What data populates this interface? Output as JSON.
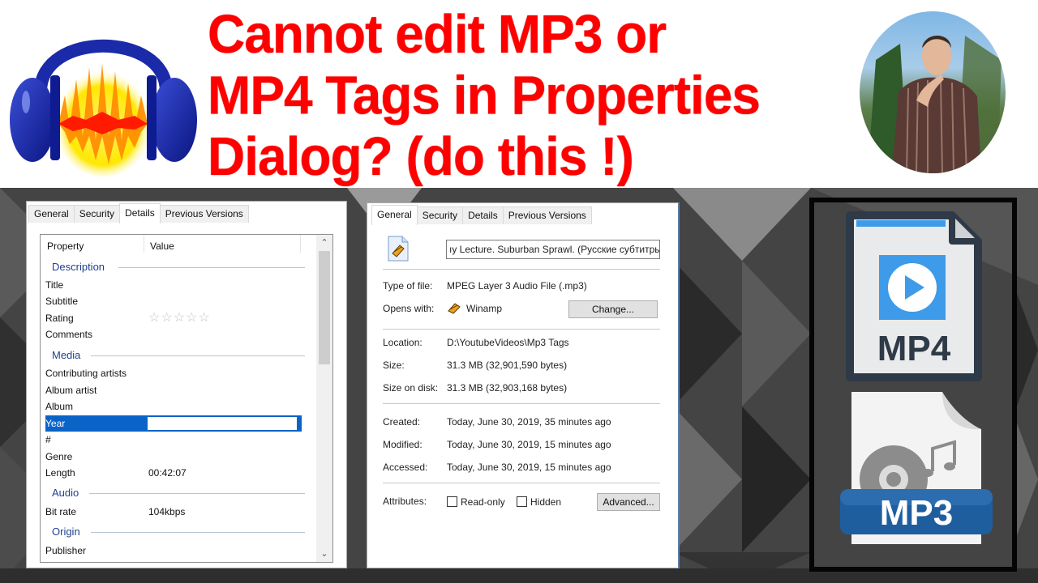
{
  "banner": {
    "logo": "audacity-headphones-logo",
    "headline_lines": [
      "Cannot edit MP3 or",
      "MP4 Tags in Properties",
      "Dialog? (do this !)"
    ],
    "avatar": "presenter-photo",
    "headline_color": "#ff0000"
  },
  "details_dialog": {
    "tabs": [
      "General",
      "Security",
      "Details",
      "Previous Versions"
    ],
    "active_tab": "Details",
    "columns": [
      "Property",
      "Value"
    ],
    "groups": {
      "description": "Description",
      "media": "Media",
      "audio": "Audio",
      "origin": "Origin"
    },
    "rows": {
      "title": {
        "label": "Title",
        "value": ""
      },
      "subtitle": {
        "label": "Subtitle",
        "value": ""
      },
      "rating": {
        "label": "Rating",
        "value": "☆☆☆☆☆",
        "stars_filled": 0,
        "stars_total": 5
      },
      "comments": {
        "label": "Comments",
        "value": ""
      },
      "contributing_artists": {
        "label": "Contributing artists",
        "value": ""
      },
      "album_artist": {
        "label": "Album artist",
        "value": ""
      },
      "album": {
        "label": "Album",
        "value": ""
      },
      "year": {
        "label": "Year",
        "value": "",
        "selected": true
      },
      "track_number": {
        "label": "#",
        "value": ""
      },
      "genre": {
        "label": "Genre",
        "value": ""
      },
      "length": {
        "label": "Length",
        "value": "00:42:07"
      },
      "bit_rate": {
        "label": "Bit rate",
        "value": "104kbps"
      },
      "publisher": {
        "label": "Publisher",
        "value": ""
      }
    },
    "selection_color": "#0a64c8"
  },
  "general_dialog": {
    "tabs": [
      "General",
      "Security",
      "Details",
      "Previous Versions"
    ],
    "active_tab": "General",
    "file_name": "ıy Lecture. Suburban Sprawl. (Русские субтитры)",
    "type_of_file_label": "Type of file:",
    "type_of_file": "MPEG Layer 3 Audio File (.mp3)",
    "opens_with_label": "Opens with:",
    "opens_with": "Winamp",
    "change_button": "Change...",
    "location_label": "Location:",
    "location": "D:\\YoutubeVideos\\Mp3 Tags",
    "size_label": "Size:",
    "size": "31.3 MB (32,901,590 bytes)",
    "size_on_disk_label": "Size on disk:",
    "size_on_disk": "31.3 MB (32,903,168 bytes)",
    "created_label": "Created:",
    "created": "Today, June 30, 2019, 35 minutes ago",
    "modified_label": "Modified:",
    "modified": "Today, June 30, 2019, 15 minutes ago",
    "accessed_label": "Accessed:",
    "accessed": "Today, June 30, 2019, 15 minutes ago",
    "attributes_label": "Attributes:",
    "readonly_label": "Read-only",
    "readonly_checked": false,
    "hidden_label": "Hidden",
    "hidden_checked": false,
    "advanced_button": "Advanced..."
  },
  "icon_panel": {
    "mp4_label": "MP4",
    "mp3_label": "MP3",
    "mp4_accent": "#3d9be9",
    "mp3_accent": "#1f5e9e"
  }
}
